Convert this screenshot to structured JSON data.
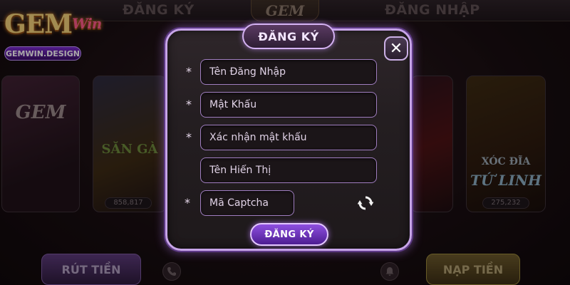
{
  "app": {
    "brand_logo_text": "GEM",
    "brand_logo_accent": "Win",
    "brand_badge": "GEMWIN.DESIGN"
  },
  "top_bar": {
    "register_tab": "ĐĂNG KÝ",
    "login_tab": "ĐĂNG NHẬP",
    "center_logo": "GEM"
  },
  "lobby": {
    "cards": [
      {
        "title": "GEM",
        "count": ""
      },
      {
        "title": "SĂN GÀ",
        "count": "858,817"
      },
      {
        "title": "",
        "count": ""
      },
      {
        "title": "XÓC ĐĨA",
        "subtitle": "TỨ LINH",
        "count": "275,232"
      }
    ],
    "bottom": {
      "withdraw": "RÚT TIỀN",
      "deposit": "NẠP TIỀN"
    }
  },
  "modal": {
    "title": "ĐĂNG KÝ",
    "close_symbol": "✕",
    "required_mark": "*",
    "fields": {
      "username_placeholder": "Tên Đăng Nhập",
      "password_placeholder": "Mật Khẩu",
      "confirm_placeholder": "Xác nhận mật khẩu",
      "display_name_placeholder": "Tên Hiển Thị",
      "captcha_placeholder": "Mã Captcha"
    },
    "submit_label": "ĐĂNG KÝ"
  },
  "colors": {
    "accent_purple": "#8e4fe0",
    "border_lilac": "#c7a4e8",
    "gold": "#f4d47a"
  },
  "icons": {
    "close": "close-icon",
    "refresh": "refresh-icon",
    "phone": "phone-icon",
    "bell": "bell-icon"
  }
}
